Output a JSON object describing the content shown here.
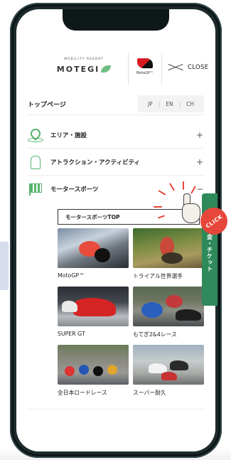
{
  "header": {
    "logo_motegi_sub": "MOBILITY RESORT",
    "logo_motegi_main": "MOTEGI",
    "logo_motogp_text": "MotoGP™",
    "close_label": "CLOSE"
  },
  "toprow": {
    "title": "トップページ",
    "languages": [
      "JP",
      "EN",
      "CH"
    ]
  },
  "nav": [
    {
      "label": "エリア・施設",
      "toggle": "+",
      "icon": "map-pin-icon"
    },
    {
      "label": "アトラクション・アクティビティ",
      "toggle": "+",
      "icon": "tree-icon"
    },
    {
      "label": "モータースポーツ",
      "toggle": "−",
      "icon": "checkered-flag-icon"
    }
  ],
  "motorsports": {
    "top_button": "モータースポーツTOP",
    "tiles": [
      {
        "label": "MotoGP™"
      },
      {
        "label": "トライアル世界選手"
      },
      {
        "label": "SUPER GT"
      },
      {
        "label": "もてぎ2&4レース"
      },
      {
        "label": "全日本ロードレース"
      },
      {
        "label": "スーパー耐久"
      }
    ]
  },
  "side_tab": {
    "label": "料金・チケット"
  },
  "annotation": {
    "click_label": "CLICK"
  },
  "colors": {
    "accent_green": "#58b36d",
    "ticket_green": "#2e8a5a",
    "click_red": "#e6473a"
  }
}
